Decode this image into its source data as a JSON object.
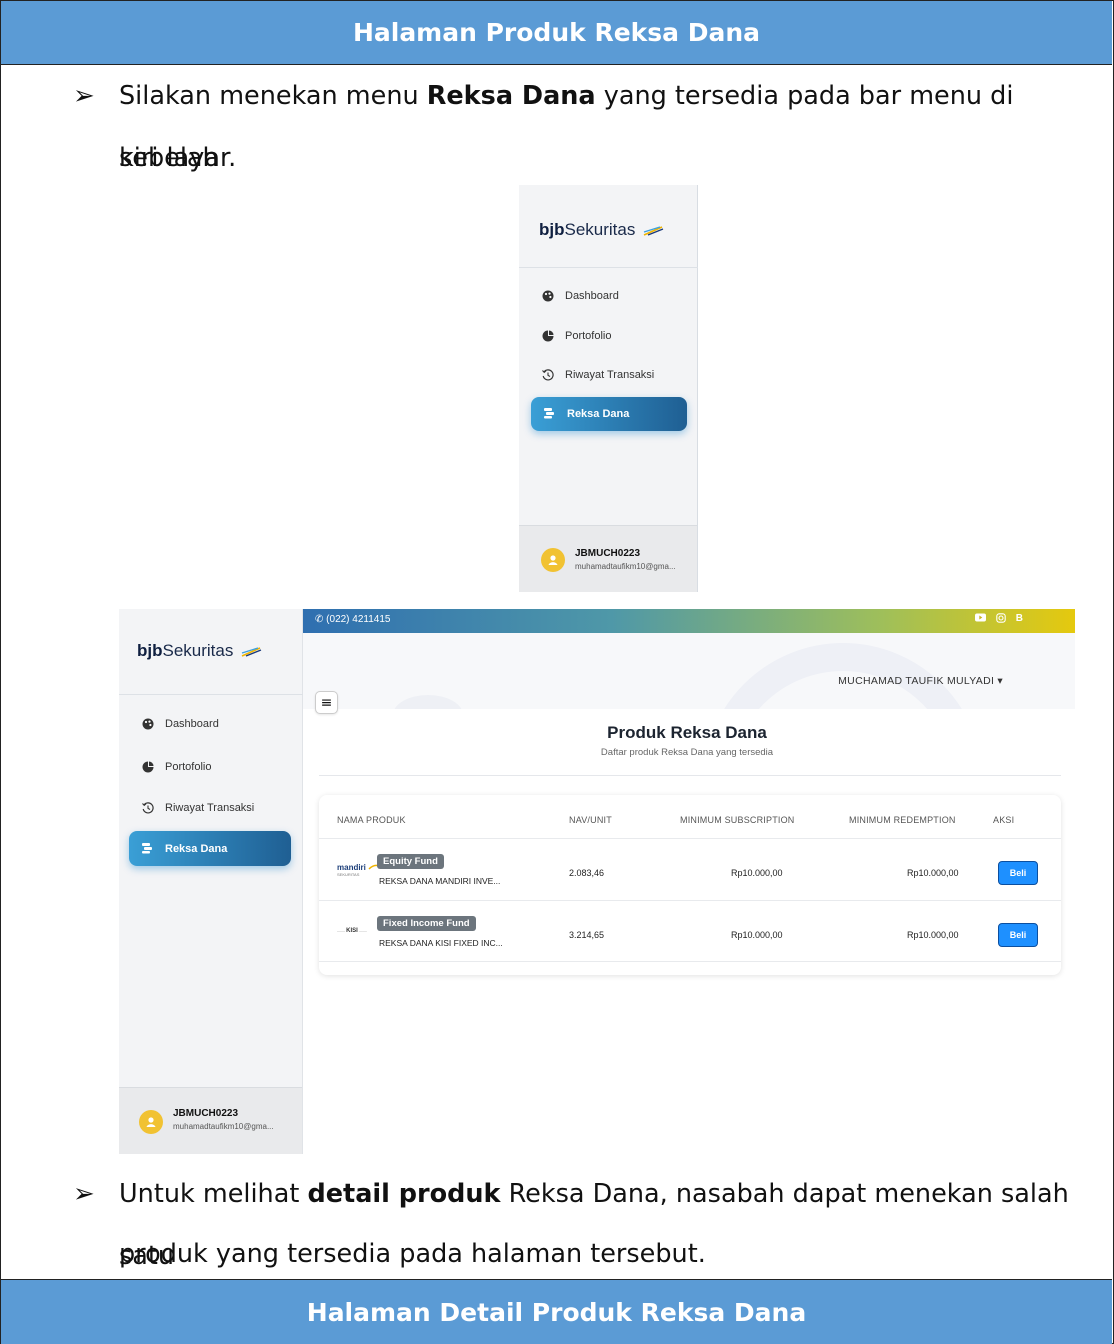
{
  "doc": {
    "section1_title": "Halaman Produk Reksa Dana",
    "section2_title": "Halaman Detail Produk Reksa Dana",
    "bullet_glyph": "➢",
    "step1": {
      "pre": "Silakan menekan menu ",
      "bold": "Reksa Dana",
      "post": " yang tersedia pada bar menu di sebelah",
      "line2": "kiri layar."
    },
    "step2": {
      "pre": "Untuk melihat ",
      "bold": "detail produk",
      "post": " Reksa Dana, nasabah dapat menekan salah satu",
      "line2": "produk yang tersedia pada halaman tersebut."
    }
  },
  "brand": {
    "bold": "bjb",
    "rest": "Sekuritas"
  },
  "sidebar": {
    "items": [
      {
        "label": "Dashboard",
        "icon": "palette-icon"
      },
      {
        "label": "Portofolio",
        "icon": "pie-chart-icon"
      },
      {
        "label": "Riwayat Transaksi",
        "icon": "history-icon"
      },
      {
        "label": "Reksa Dana",
        "icon": "coins-icon",
        "active": true
      }
    ],
    "user": {
      "code": "JBMUCH0223",
      "email": "muhamadtaufikm10@gma..."
    }
  },
  "app": {
    "phone": "(022) 4211415",
    "social": [
      "youtube-icon",
      "instagram-icon",
      "B"
    ],
    "user_name": "MUCHAMAD TAUFIK MULYADI",
    "menu_glyph": "≡",
    "page_title": "Produk Reksa Dana",
    "page_subtitle": "Daftar produk Reksa Dana yang tersedia",
    "columns": [
      "NAMA PRODUK",
      "NAV/UNIT",
      "MINIMUM SUBSCRIPTION",
      "MINIMUM REDEMPTION",
      "AKSI"
    ],
    "rows": [
      {
        "logo": "mandiri",
        "logo_sub": "SEKURITAS",
        "badge": "Equity Fund",
        "name": "REKSA DANA MANDIRI INVE...",
        "nav": "2.083,46",
        "min_sub": "Rp10.000,00",
        "min_red": "Rp10.000,00",
        "action": "Beli"
      },
      {
        "logo": "KISI",
        "logo_sub": "",
        "badge": "Fixed Income Fund",
        "name": "REKSA DANA KISI FIXED INC...",
        "nav": "3.214,65",
        "min_sub": "Rp10.000,00",
        "min_red": "Rp10.000,00",
        "action": "Beli"
      }
    ]
  },
  "colors": {
    "band": "#5b9bd5",
    "active": "#2a86c4",
    "buy": "#1e90ff",
    "badge": "#6c757d"
  }
}
